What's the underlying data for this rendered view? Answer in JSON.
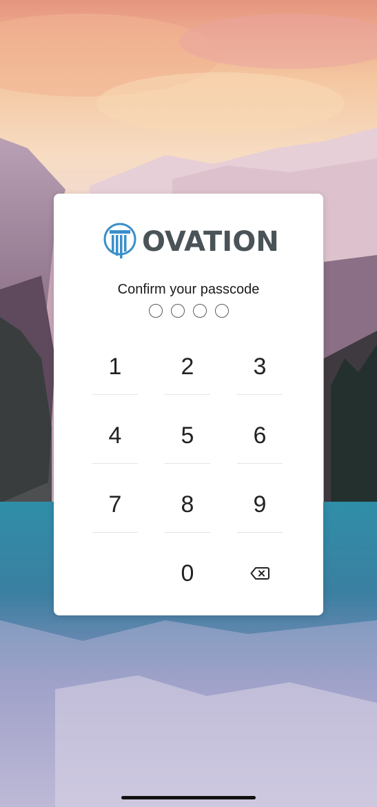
{
  "brand": {
    "name": "OVATION",
    "text_color": "#4a5358",
    "accent_color": "#3a8fc9"
  },
  "passcode": {
    "prompt": "Confirm your passcode",
    "dot_count": 4,
    "filled": 0
  },
  "keypad": {
    "keys": [
      "1",
      "2",
      "3",
      "4",
      "5",
      "6",
      "7",
      "8",
      "9",
      "0"
    ],
    "delete_icon": "backspace-icon"
  }
}
